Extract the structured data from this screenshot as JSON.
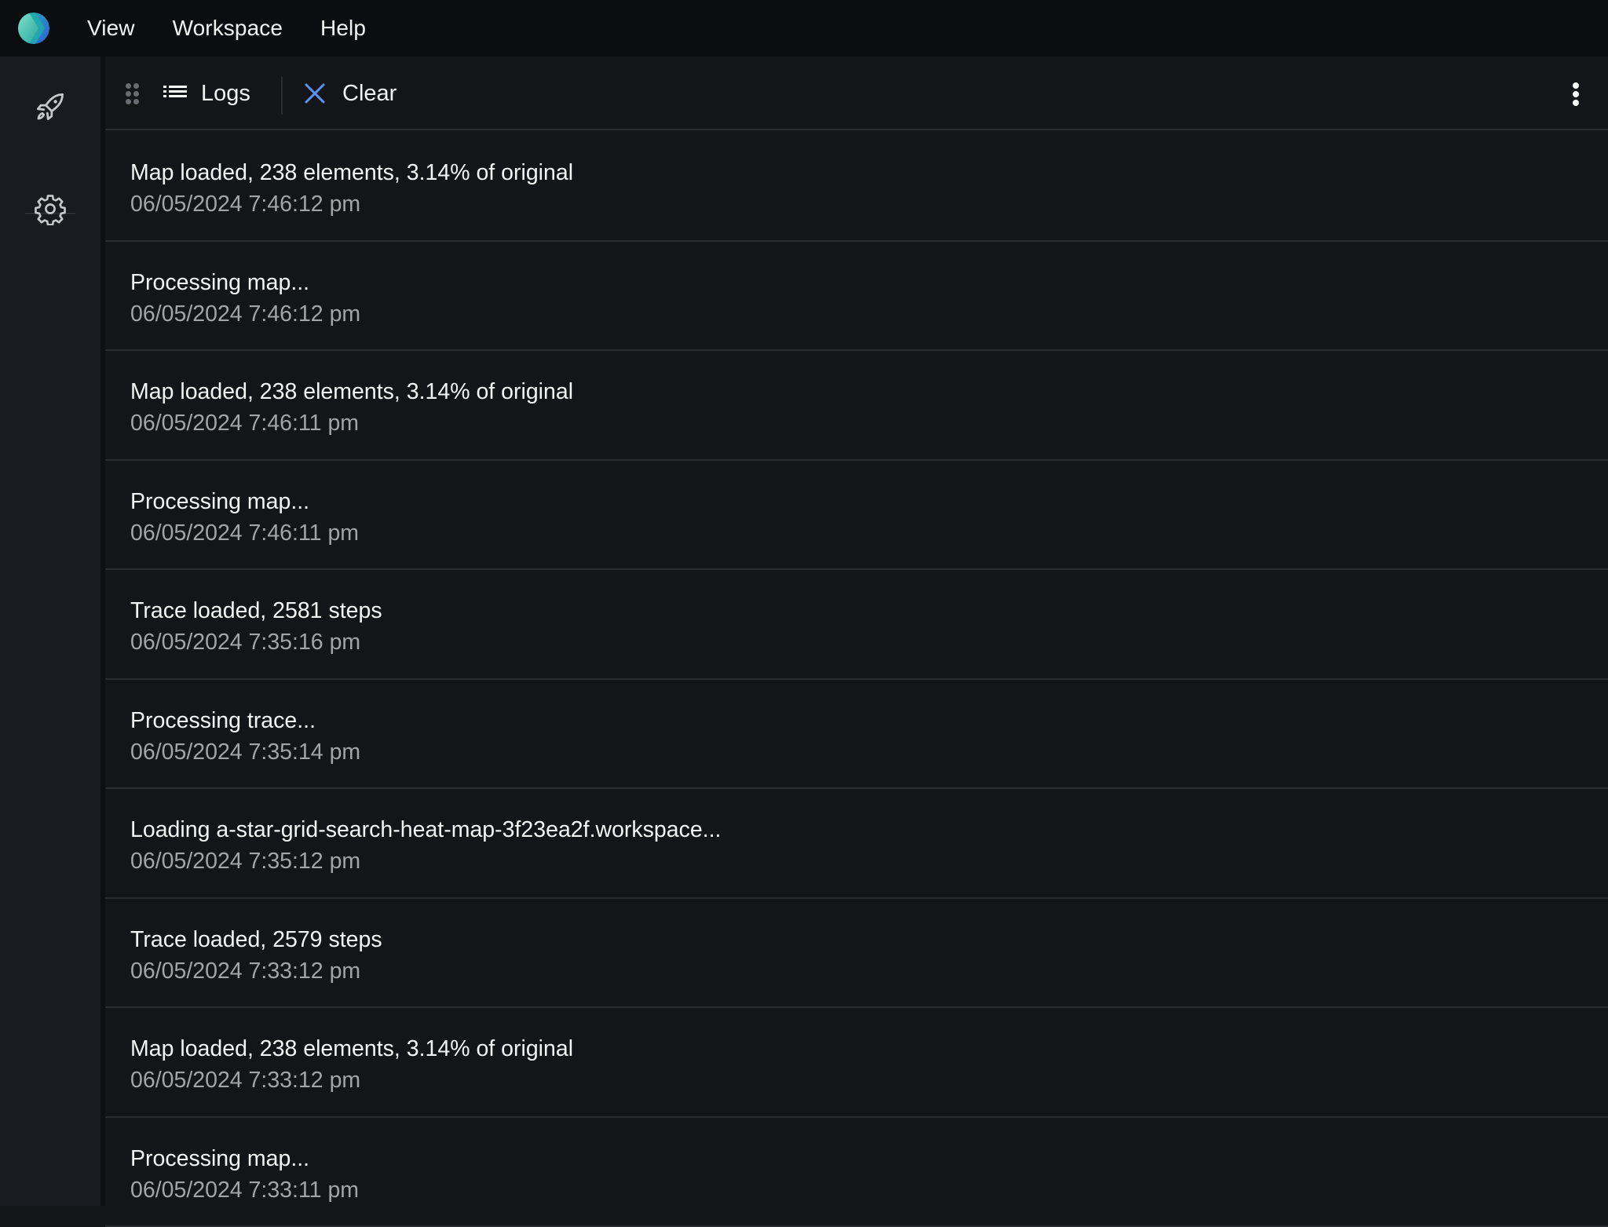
{
  "app_bar": {
    "logo_icon": "app-logo",
    "menu": [
      {
        "label": "View"
      },
      {
        "label": "Workspace"
      },
      {
        "label": "Help"
      }
    ]
  },
  "sidebar": {
    "items": [
      {
        "icon": "rocket-icon",
        "label": "Run"
      },
      {
        "icon": "gear-icon",
        "label": "Settings"
      }
    ]
  },
  "panel": {
    "toolbar": {
      "drag_icon": "drag-handle-icon",
      "tab_icon": "list-icon",
      "tab_label": "Logs",
      "clear_icon": "close-icon",
      "clear_label": "Clear",
      "more_icon": "more-vertical-icon",
      "clear_icon_color": "#5b93f0"
    },
    "logs": [
      {
        "message": "Map loaded, 238 elements, 3.14% of original",
        "timestamp": "06/05/2024 7:46:12 pm"
      },
      {
        "message": "Processing map...",
        "timestamp": "06/05/2024 7:46:12 pm"
      },
      {
        "message": "Map loaded, 238 elements, 3.14% of original",
        "timestamp": "06/05/2024 7:46:11 pm"
      },
      {
        "message": "Processing map...",
        "timestamp": "06/05/2024 7:46:11 pm"
      },
      {
        "message": "Trace loaded, 2581 steps",
        "timestamp": "06/05/2024 7:35:16 pm"
      },
      {
        "message": "Processing trace...",
        "timestamp": "06/05/2024 7:35:14 pm"
      },
      {
        "message": "Loading a-star-grid-search-heat-map-3f23ea2f.workspace...",
        "timestamp": "06/05/2024 7:35:12 pm"
      },
      {
        "message": "Trace loaded, 2579 steps",
        "timestamp": "06/05/2024 7:33:12 pm"
      },
      {
        "message": "Map loaded, 238 elements, 3.14% of original",
        "timestamp": "06/05/2024 7:33:12 pm"
      },
      {
        "message": "Processing map...",
        "timestamp": "06/05/2024 7:33:11 pm"
      }
    ]
  }
}
